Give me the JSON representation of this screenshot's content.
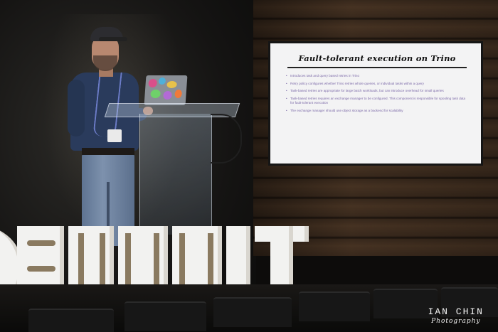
{
  "slide": {
    "title": "Fault-tolerant execution on Trino",
    "bullets": [
      "Introduces task and query based retries in Trino",
      "Retry policy configures whether Trino retries whole queries, or individual tasks within a query",
      "Task-based retries are appropriate for large batch workloads, but can introduce overhead for small queries",
      "Task-based retries requires an exchange manager to be configured. This component is responsible for spooling task data for fault-tolerant execution",
      "The exchange manager should use object storage as a backend for scalability"
    ]
  },
  "signage": {
    "letters": "OSUMMIT"
  },
  "watermark": {
    "name": "IAN CHIN",
    "subtitle": "Photography"
  },
  "colors": {
    "slide_bg": "#f3f3f4",
    "bullet_text": "#7c6aa8",
    "sign_letters": "#f2f2f0",
    "wood_wall": "#4a3524"
  }
}
